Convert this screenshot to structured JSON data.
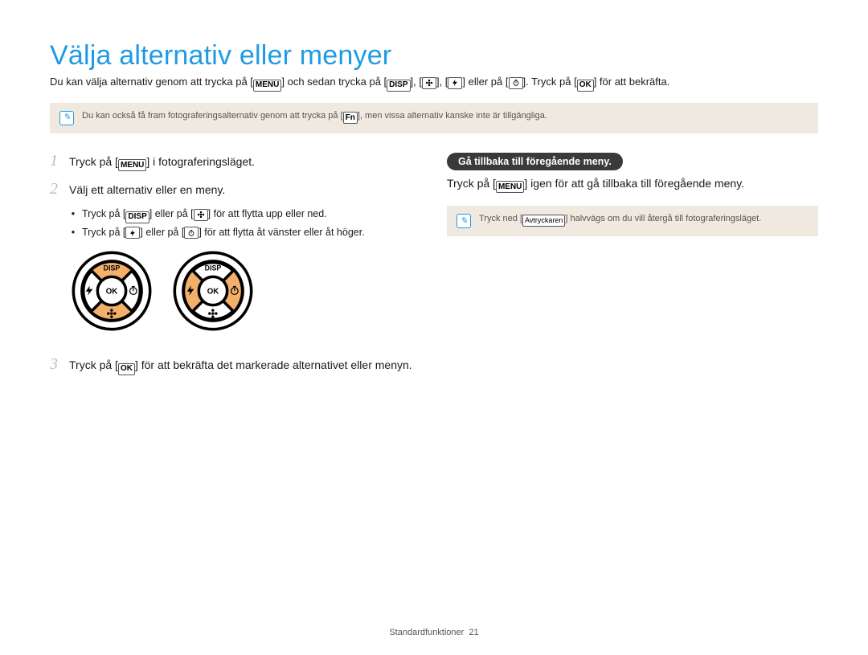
{
  "title": "Välja alternativ eller menyer",
  "intro": {
    "part1": "Du kan välja alternativ genom att trycka på [",
    "menu": "MENU",
    "part2": "] och sedan trycka på [",
    "disp": "DISP",
    "part3": "], [",
    "macro": "macro",
    "part4": "], [",
    "flash": "flash",
    "part5": "] eller på [",
    "timer": "timer",
    "part6": "]. Tryck på [",
    "ok": "OK",
    "part7": "] för att bekräfta."
  },
  "note_top": {
    "pre": "Du kan också få fram fotograferingsalternativ genom att trycka på [",
    "fn": "Fn",
    "post": "], men vissa alternativ kanske inte är tillgängliga."
  },
  "steps": {
    "s1": {
      "pre": "Tryck på [",
      "menu": "MENU",
      "post": "] i fotograferingsläget."
    },
    "s2": {
      "text": "Välj ett alternativ eller en meny.",
      "b1": {
        "pre": "Tryck på [",
        "mid": "] eller på [",
        "post": "] för att flytta upp eller ned."
      },
      "b2": {
        "pre": "Tryck på [",
        "mid": "] eller på [",
        "post": "] för att flytta åt vänster eller åt höger."
      }
    },
    "s3": {
      "pre": "Tryck på [",
      "ok": "OK",
      "post": "] för att bekräfta det markerade alternativet eller menyn."
    }
  },
  "dial": {
    "disp": "DISP",
    "ok": "OK"
  },
  "right": {
    "heading": "Gå tillbaka till föregående meny.",
    "para_pre": "Tryck på [",
    "menu": "MENU",
    "para_post": "] igen för att gå tillbaka till föregående meny.",
    "note_pre": "Tryck ned [",
    "note_key": "Avtryckaren",
    "note_post": "] halvvägs om du vill återgå till fotograferingsläget."
  },
  "footer": {
    "section": "Standardfunktioner",
    "page": "21"
  },
  "nums": {
    "n1": "1",
    "n2": "2",
    "n3": "3"
  },
  "bullet": "•"
}
